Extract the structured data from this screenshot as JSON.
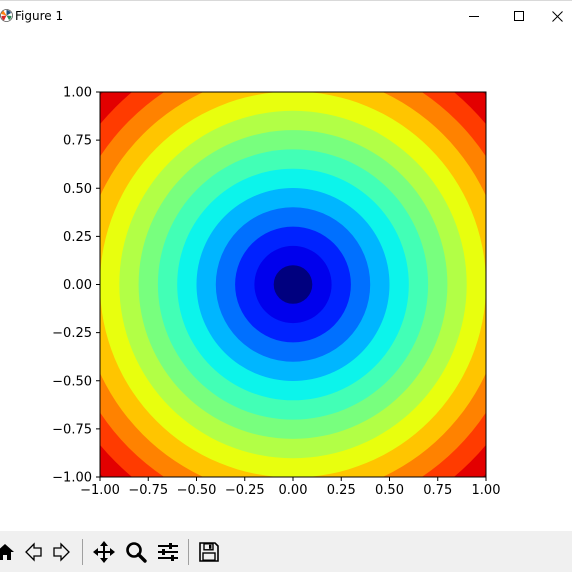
{
  "window": {
    "title": "Figure 1"
  },
  "chart_data": {
    "type": "heatmap",
    "title": "",
    "xlabel": "",
    "ylabel": "",
    "xlim": [
      -1.0,
      1.0
    ],
    "ylim": [
      -1.0,
      1.0
    ],
    "xticks": [
      "−1.00",
      "−0.75",
      "−0.50",
      "−0.25",
      "0.00",
      "0.25",
      "0.50",
      "0.75",
      "1.00"
    ],
    "yticks": [
      "1.00",
      "0.75",
      "0.50",
      "0.25",
      "0.00",
      "−0.25",
      "−0.50",
      "−0.75",
      "−1.00"
    ],
    "xtick_values": [
      -1.0,
      -0.75,
      -0.5,
      -0.25,
      0.0,
      0.25,
      0.5,
      0.75,
      1.0
    ],
    "ytick_values": [
      1.0,
      0.75,
      0.5,
      0.25,
      0.0,
      -0.25,
      -0.5,
      -0.75,
      -1.0
    ],
    "function": "sqrt(x^2 + y^2)",
    "colormap": "jet",
    "contour_levels": [
      0.0,
      0.1,
      0.2,
      0.3,
      0.4,
      0.5,
      0.6,
      0.7,
      0.8,
      0.9,
      1.0,
      1.1,
      1.2,
      1.3,
      1.4,
      1.5
    ],
    "level_colors": [
      "#00007f",
      "#0000ed",
      "#0022ff",
      "#0070ff",
      "#00b6ff",
      "#0cf4eb",
      "#42ffb6",
      "#78ff7e",
      "#b2ff46",
      "#e8ff0e",
      "#ffc500",
      "#ff8200",
      "#ff3b00",
      "#e30000",
      "#b00000"
    ],
    "grid": false,
    "legend": "none"
  },
  "toolbar": {
    "icons": [
      "home-icon",
      "back-icon",
      "forward-icon",
      "pan-icon",
      "zoom-icon",
      "configure-subplots-icon",
      "save-icon"
    ]
  }
}
